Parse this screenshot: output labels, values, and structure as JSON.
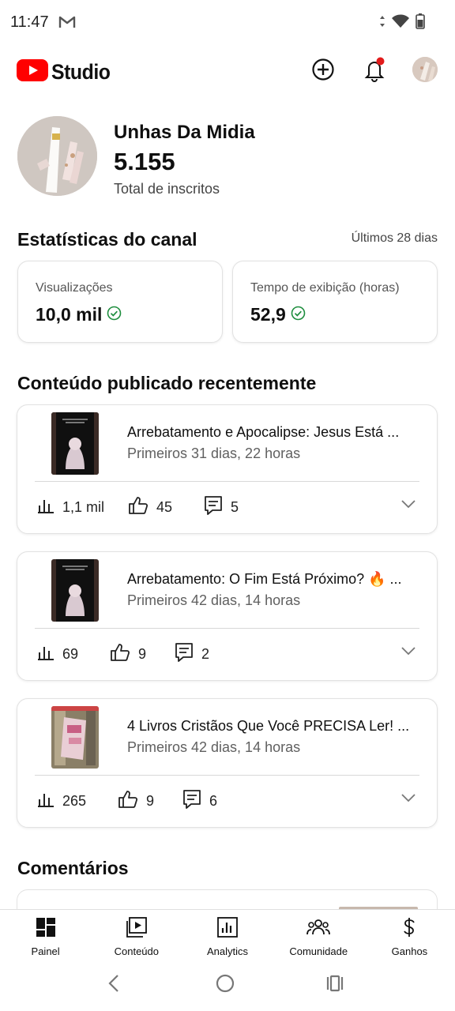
{
  "status_bar": {
    "time": "11:47"
  },
  "header": {
    "logo_text": "Studio"
  },
  "channel": {
    "name": "Unhas Da Midia",
    "subscriber_count": "5.155",
    "subscriber_label": "Total de inscritos"
  },
  "stats": {
    "title": "Estatísticas do canal",
    "period": "Últimos 28 dias",
    "cards": [
      {
        "label": "Visualizações",
        "value": "10,0 mil"
      },
      {
        "label": "Tempo de exibição (horas)",
        "value": "52,9"
      }
    ]
  },
  "recent": {
    "title": "Conteúdo publicado recentemente",
    "videos": [
      {
        "title": "Arrebatamento e Apocalipse: Jesus Está ...",
        "age": "Primeiros 31 dias, 22 horas",
        "views": "1,1 mil",
        "likes": "45",
        "comments": "5"
      },
      {
        "title": "Arrebatamento: O Fim Está Próximo? 🔥 ...",
        "age": "Primeiros 42 dias, 14 horas",
        "views": "69",
        "likes": "9",
        "comments": "2"
      },
      {
        "title": "4 Livros Cristãos Que Você PRECISA Ler! ...",
        "age": "Primeiros 42 dias, 14 horas",
        "views": "265",
        "likes": "9",
        "comments": "6"
      }
    ]
  },
  "comments_section": {
    "title": "Comentários"
  },
  "bottom_nav": {
    "items": [
      {
        "label": "Painel",
        "icon": "dashboard-icon"
      },
      {
        "label": "Conteúdo",
        "icon": "content-icon"
      },
      {
        "label": "Analytics",
        "icon": "analytics-icon"
      },
      {
        "label": "Comunidade",
        "icon": "community-icon"
      },
      {
        "label": "Ganhos",
        "icon": "earnings-icon"
      }
    ]
  },
  "colors": {
    "brand_red": "#ff0000",
    "check_green": "#1e8e3e",
    "notification_dot": "#e21b1b"
  }
}
